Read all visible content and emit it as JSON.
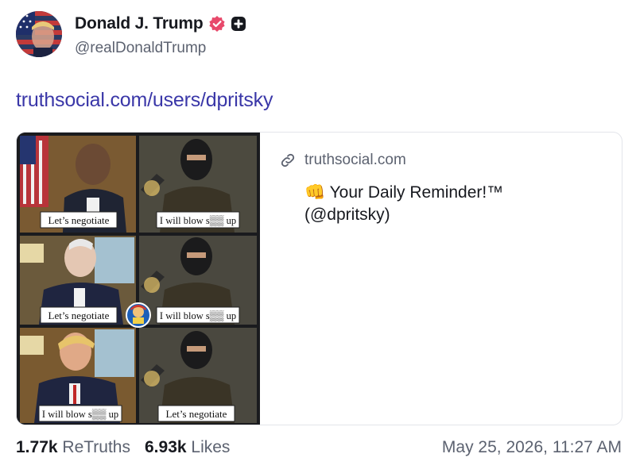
{
  "author": {
    "display_name": "Donald J. Trump",
    "handle": "@realDonaldTrump",
    "avatar_icon": "flag-portrait-avatar",
    "verified_icon": "verified-badge-icon",
    "verified_color": "#e8496b",
    "extra_badge_icon": "plus-badge-icon"
  },
  "post": {
    "link_text": "truthsocial.com/users/dpritsky",
    "link_color": "#3a37a8"
  },
  "card": {
    "domain": "truthsocial.com",
    "title_line1": "👊 Your Daily Reminder!™",
    "title_line2": "(@dpritsky)",
    "image": {
      "panels": [
        {
          "caption": "Let’s negotiate"
        },
        {
          "caption": "I will blow s▒▒ up"
        },
        {
          "caption": "Let’s negotiate"
        },
        {
          "caption": "I will blow s▒▒ up"
        },
        {
          "caption": "I will blow s▒▒ up"
        },
        {
          "caption": "Let’s negotiate"
        }
      ]
    }
  },
  "stats": {
    "retruths_count": "1.77k",
    "retruths_label": "ReTruths",
    "likes_count": "6.93k",
    "likes_label": "Likes"
  },
  "timestamp": "May 25, 2026, 11:27 AM"
}
